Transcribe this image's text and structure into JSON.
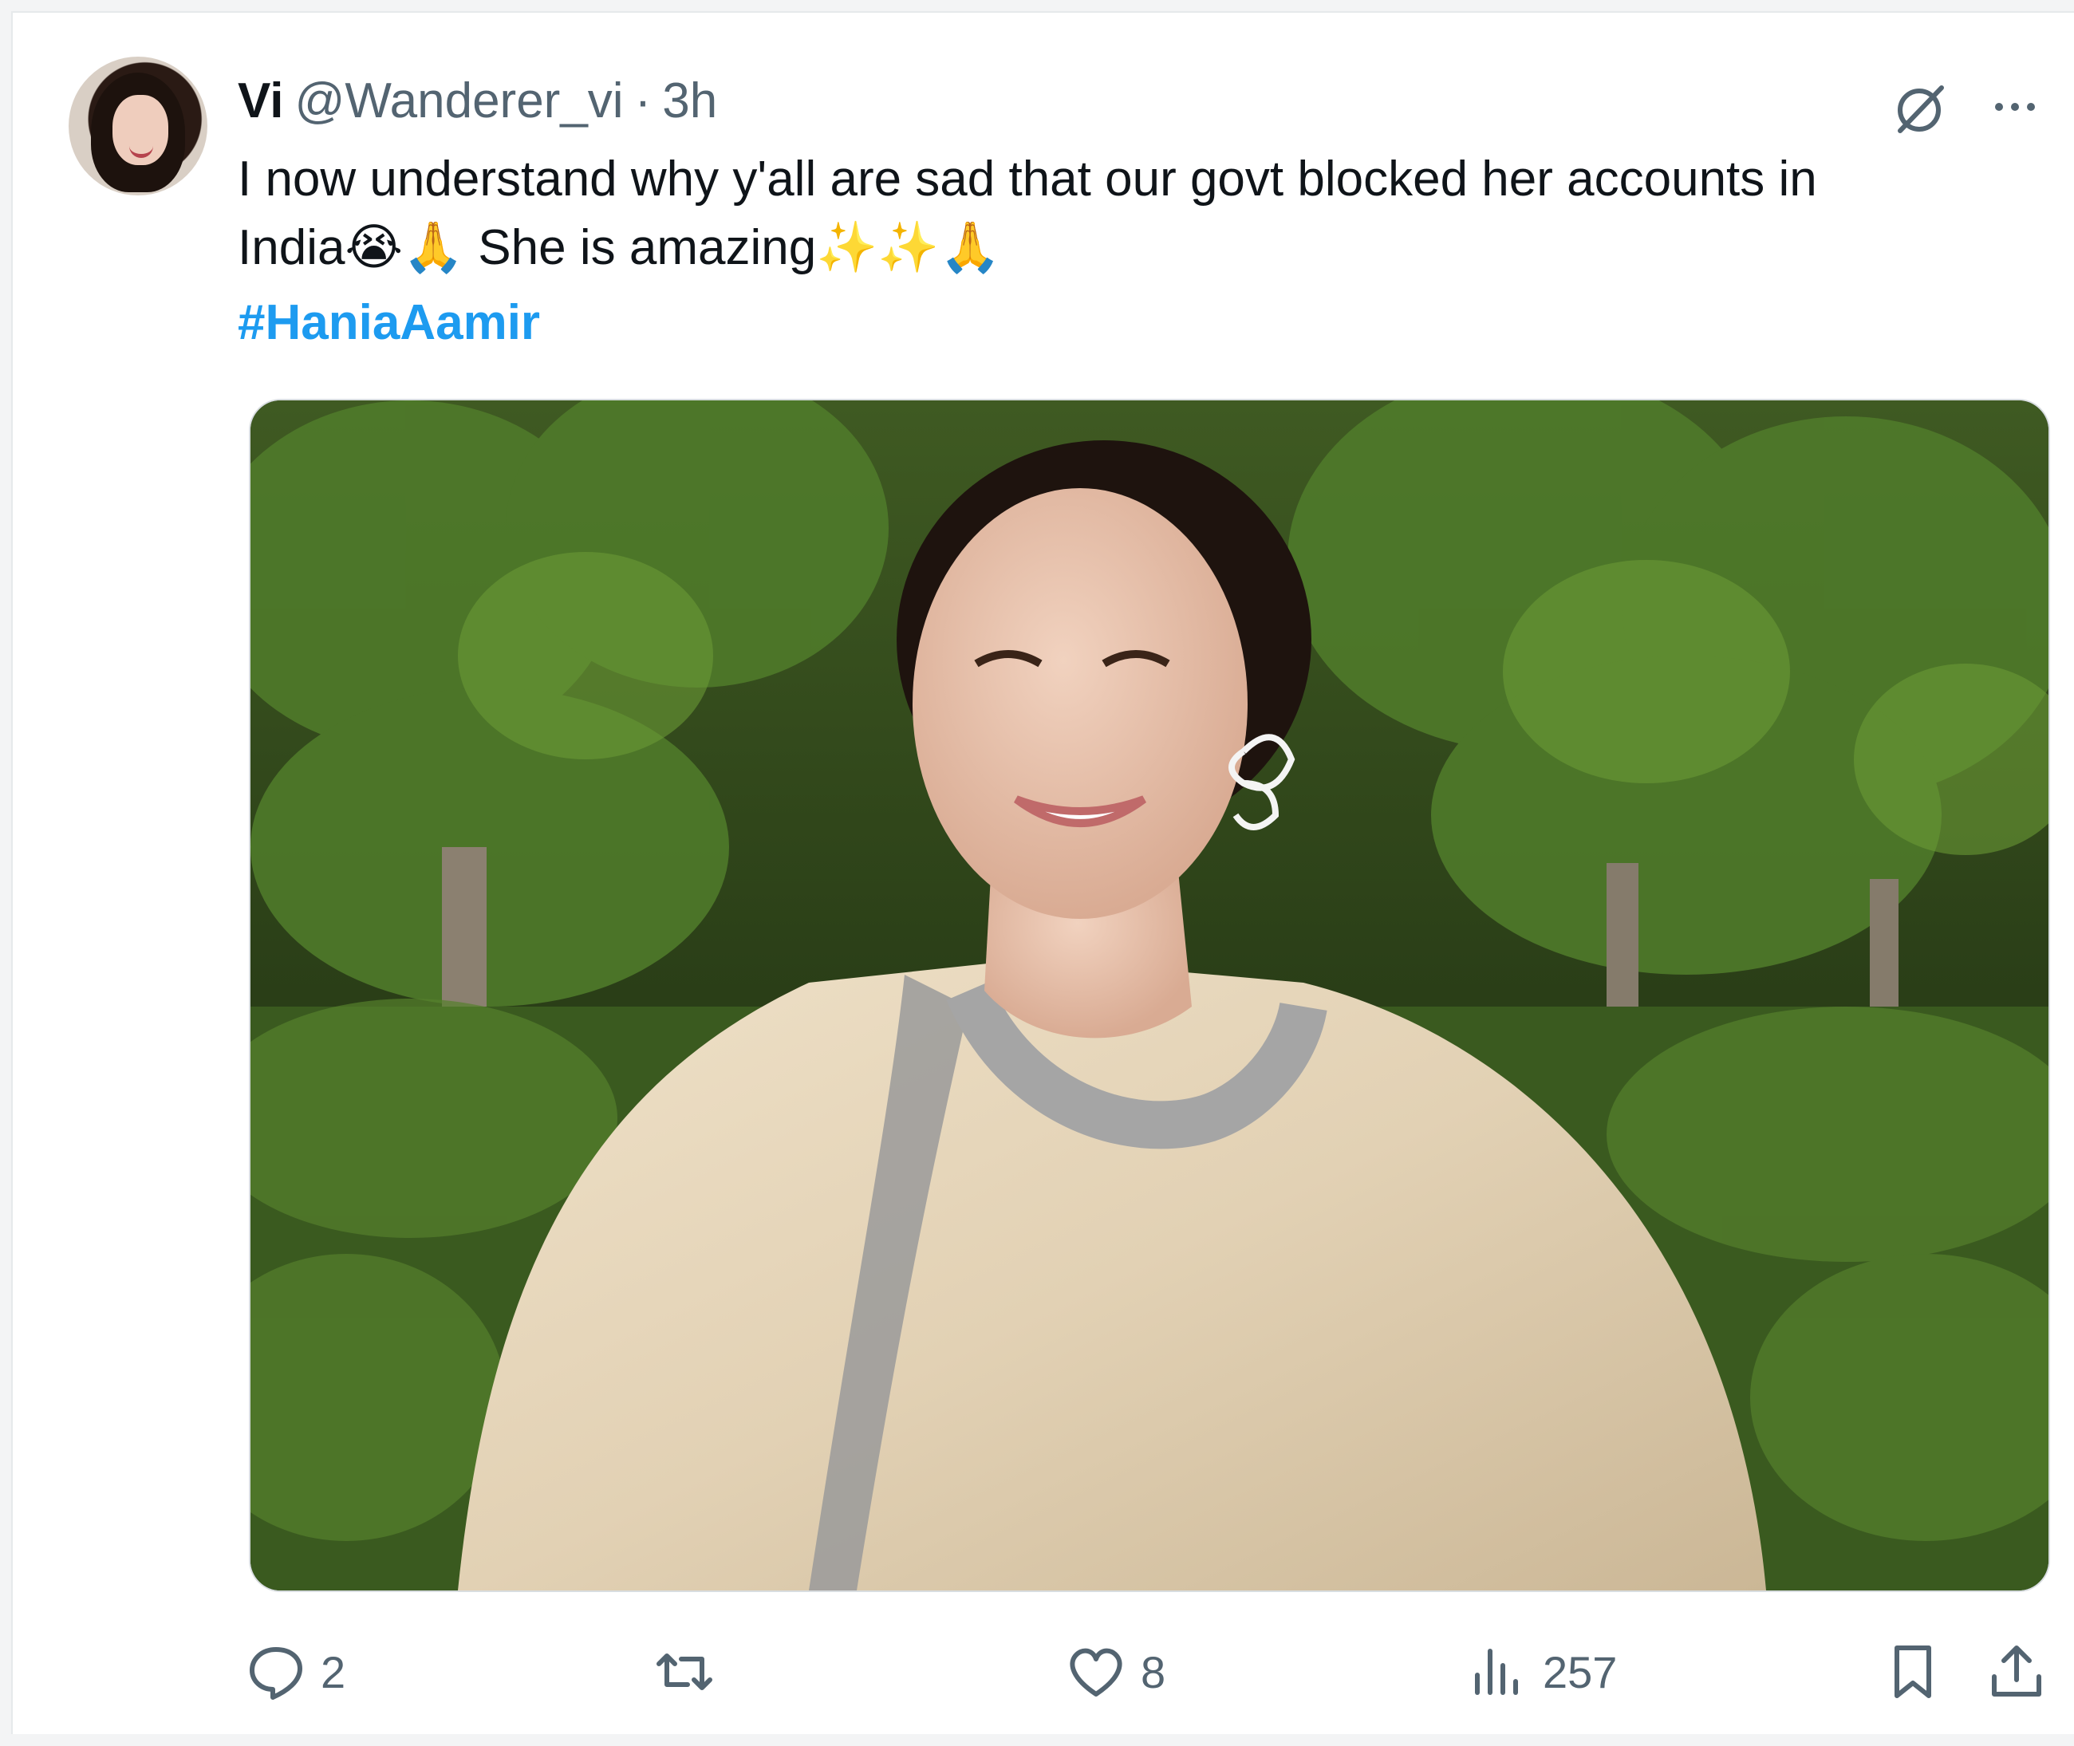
{
  "tweet": {
    "author_name": "Vi",
    "author_handle": "@Wanderer_vi",
    "separator": "·",
    "time": "3h",
    "text_line1": "I now understand why  y'all are sad that our govt blocked her accounts in",
    "text_line2": "India😭🙏 She is amazing✨✨🙏",
    "hashtag": "#HaniaAamir"
  },
  "actions": {
    "replies": "2",
    "retweets": "",
    "likes": "8",
    "views": "257"
  },
  "icons": [
    "grok-icon",
    "more-icon",
    "reply-icon",
    "retweet-icon",
    "like-icon",
    "views-icon",
    "bookmark-icon",
    "share-icon"
  ],
  "colors": {
    "link": "#1d9bf0",
    "secondary_text": "#536471",
    "primary_text": "#0f1419"
  }
}
